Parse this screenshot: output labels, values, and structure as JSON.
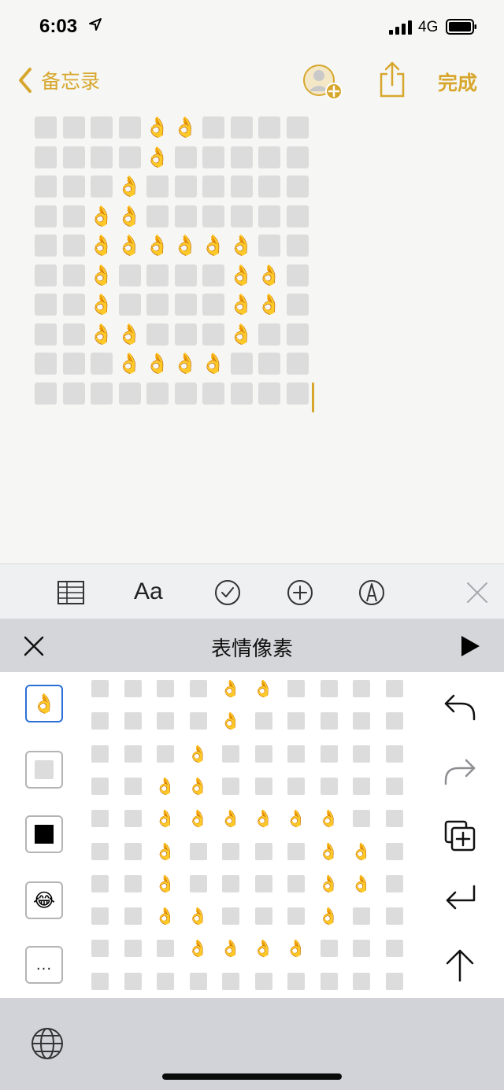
{
  "status_bar": {
    "time": "6:03",
    "network": "4G"
  },
  "nav": {
    "back_label": "备忘录",
    "done_label": "完成"
  },
  "note": {
    "cell_emoji": "👌",
    "pattern": [
      "....XX....",
      "....X.....",
      "...X......",
      "..XX......",
      "..XXXXXX..",
      "..X....XX.",
      "..X....XX.",
      "..XX...X..",
      "...XXXX...",
      ".........."
    ]
  },
  "format_toolbar": {
    "items": [
      "table-icon",
      "text-style-icon",
      "checklist-icon",
      "add-icon",
      "markup-icon",
      "close-icon"
    ],
    "text_style_label": "Aa"
  },
  "extension": {
    "title": "表情像素",
    "palette": [
      {
        "kind": "emoji",
        "value": "👌",
        "selected": true
      },
      {
        "kind": "gray-square"
      },
      {
        "kind": "black-square"
      },
      {
        "kind": "emoji",
        "value": "😂"
      },
      {
        "kind": "more",
        "value": "..."
      }
    ],
    "side_actions": [
      "undo-icon",
      "redo-icon",
      "copy-icon",
      "return-icon",
      "send-up-icon"
    ],
    "accent_color": "#d7a72d",
    "selected_color": "#2b6fd6"
  }
}
